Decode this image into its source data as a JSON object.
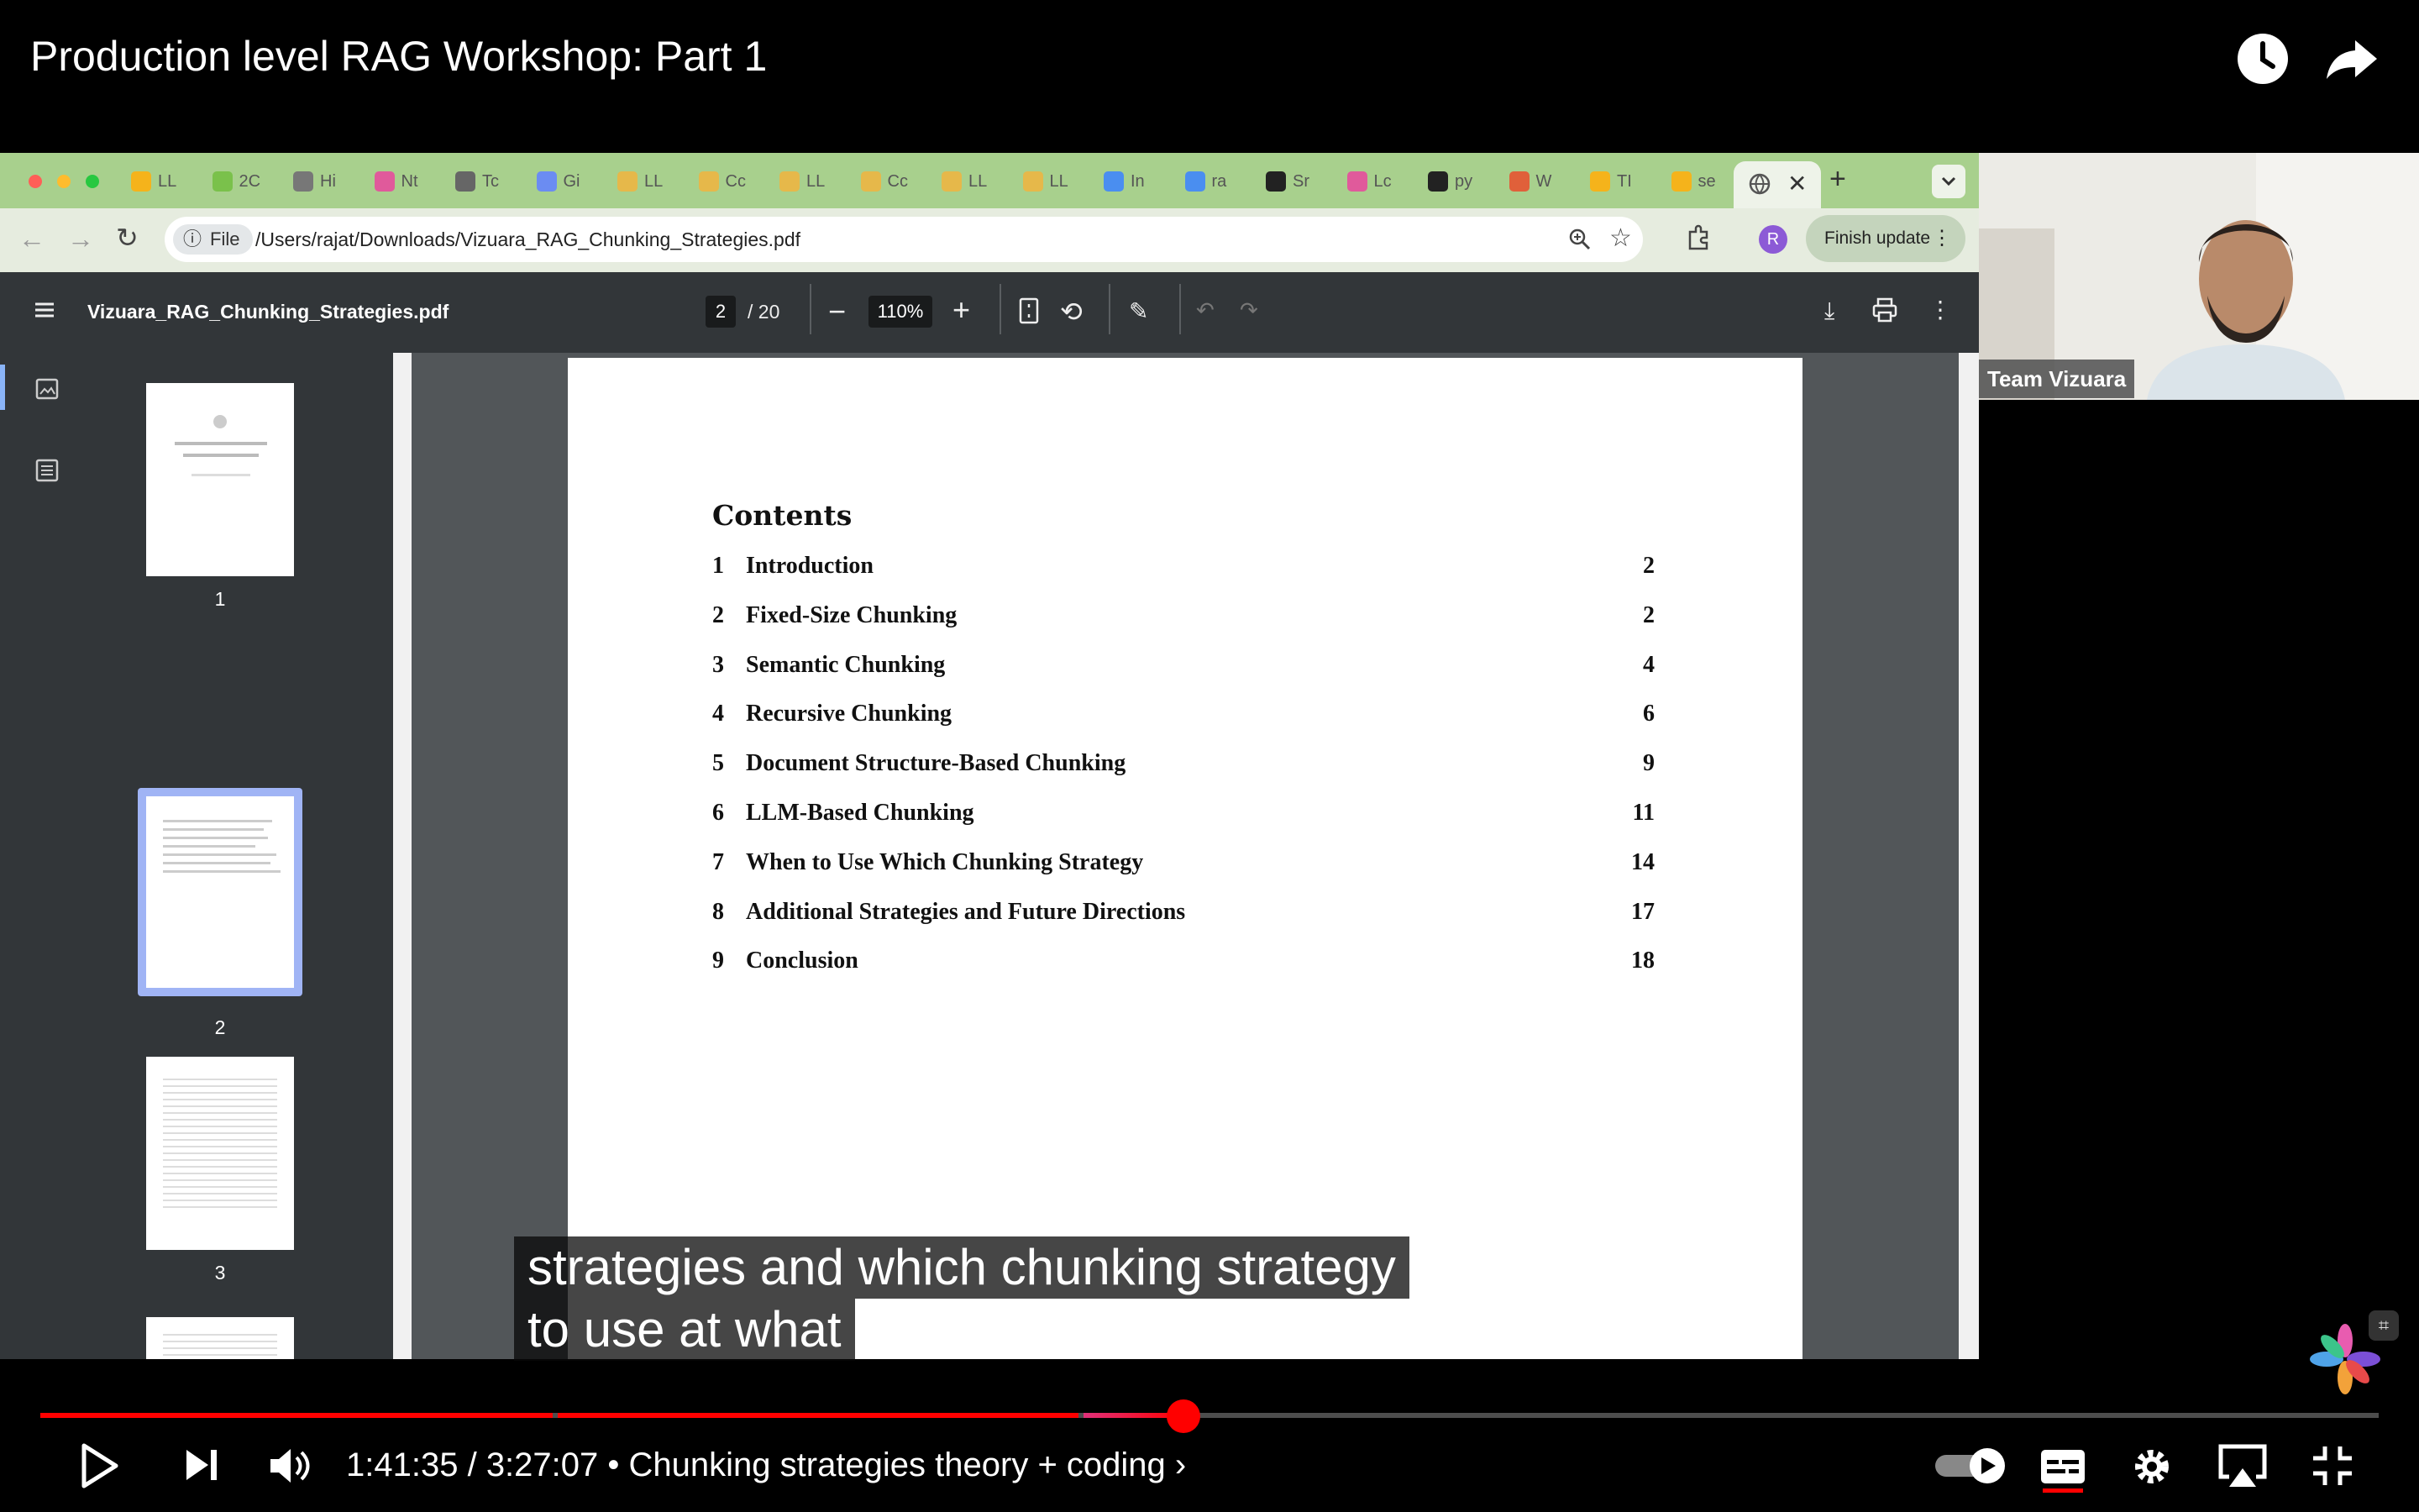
{
  "video": {
    "title": "Production level RAG Workshop: Part 1",
    "time_current": "1:41:35",
    "time_total": "3:27:07",
    "chapter": "Chunking strategies theory + coding",
    "progress_fraction": 0.489,
    "captions": [
      "strategies and which chunking strategy",
      "to use at what"
    ]
  },
  "browser": {
    "tabs": [
      "LL",
      "2C",
      "Hi",
      "Nt",
      "Tc",
      "Gi",
      "LL",
      "Cc",
      "LL",
      "Cc",
      "LL",
      "LL",
      "In",
      "ra",
      "Sr",
      "Lc",
      "py",
      "W",
      "TI",
      "se"
    ],
    "url_chip": "File",
    "url": "/Users/rajat/Downloads/Vizuara_RAG_Chunking_Strategies.pdf",
    "profile_initial": "R",
    "finish_update": "Finish update"
  },
  "pdf": {
    "filename": "Vizuara_RAG_Chunking_Strategies.pdf",
    "page_current": "2",
    "page_total": "/ 20",
    "zoom": "110%",
    "thumbnails": [
      "1",
      "2",
      "3"
    ],
    "toc_title": "Contents",
    "toc": [
      {
        "num": "1",
        "title": "Introduction",
        "page": "2"
      },
      {
        "num": "2",
        "title": "Fixed-Size Chunking",
        "page": "2"
      },
      {
        "num": "3",
        "title": "Semantic Chunking",
        "page": "4"
      },
      {
        "num": "4",
        "title": "Recursive Chunking",
        "page": "6"
      },
      {
        "num": "5",
        "title": "Document Structure-Based Chunking",
        "page": "9"
      },
      {
        "num": "6",
        "title": "LLM-Based Chunking",
        "page": "11"
      },
      {
        "num": "7",
        "title": "When to Use Which Chunking Strategy",
        "page": "14"
      },
      {
        "num": "8",
        "title": "Additional Strategies and Future Directions",
        "page": "17"
      },
      {
        "num": "9",
        "title": "Conclusion",
        "page": "18"
      }
    ]
  },
  "camera": {
    "label": "Team Vizuara"
  }
}
